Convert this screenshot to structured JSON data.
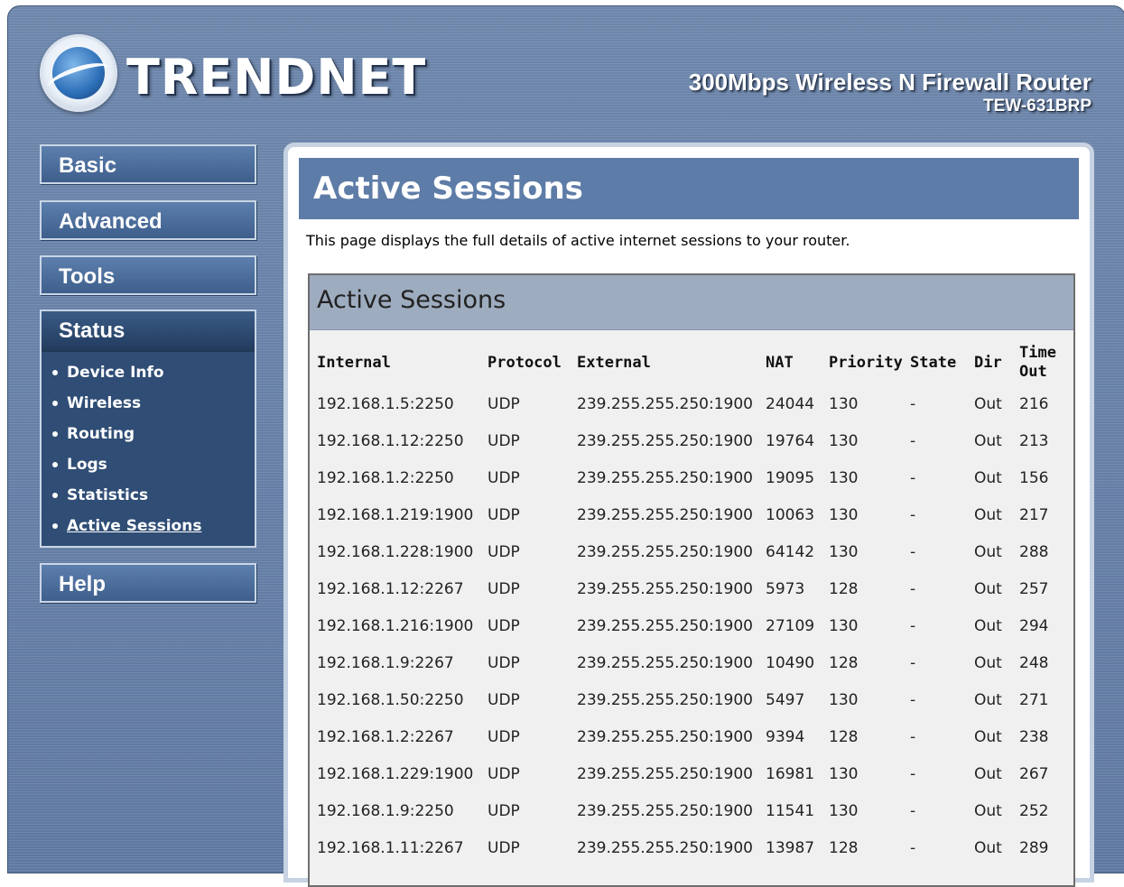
{
  "header": {
    "brand": "TRENDNET",
    "product_name": "300Mbps Wireless N Firewall Router",
    "model": "TEW-631BRP"
  },
  "sidebar": {
    "menu": [
      "Basic",
      "Advanced",
      "Tools",
      "Status",
      "Help"
    ],
    "status_items": [
      "Device Info",
      "Wireless",
      "Routing",
      "Logs",
      "Statistics",
      "Active Sessions"
    ],
    "active_item": "Active Sessions"
  },
  "page": {
    "title": "Active Sessions",
    "description": "This page displays the full details of active internet sessions to your router."
  },
  "sessions": {
    "box_title": "Active Sessions",
    "columns": [
      "Internal",
      "Protocol",
      "External",
      "NAT",
      "Priority",
      "State",
      "Dir",
      "Time Out"
    ],
    "rows": [
      [
        "192.168.1.5:2250",
        "UDP",
        "239.255.255.250:1900",
        "24044",
        "130",
        "-",
        "Out",
        "216"
      ],
      [
        "192.168.1.12:2250",
        "UDP",
        "239.255.255.250:1900",
        "19764",
        "130",
        "-",
        "Out",
        "213"
      ],
      [
        "192.168.1.2:2250",
        "UDP",
        "239.255.255.250:1900",
        "19095",
        "130",
        "-",
        "Out",
        "156"
      ],
      [
        "192.168.1.219:1900",
        "UDP",
        "239.255.255.250:1900",
        "10063",
        "130",
        "-",
        "Out",
        "217"
      ],
      [
        "192.168.1.228:1900",
        "UDP",
        "239.255.255.250:1900",
        "64142",
        "130",
        "-",
        "Out",
        "288"
      ],
      [
        "192.168.1.12:2267",
        "UDP",
        "239.255.255.250:1900",
        "5973",
        "128",
        "-",
        "Out",
        "257"
      ],
      [
        "192.168.1.216:1900",
        "UDP",
        "239.255.255.250:1900",
        "27109",
        "130",
        "-",
        "Out",
        "294"
      ],
      [
        "192.168.1.9:2267",
        "UDP",
        "239.255.255.250:1900",
        "10490",
        "128",
        "-",
        "Out",
        "248"
      ],
      [
        "192.168.1.50:2250",
        "UDP",
        "239.255.255.250:1900",
        "5497",
        "130",
        "-",
        "Out",
        "271"
      ],
      [
        "192.168.1.2:2267",
        "UDP",
        "239.255.255.250:1900",
        "9394",
        "128",
        "-",
        "Out",
        "238"
      ],
      [
        "192.168.1.229:1900",
        "UDP",
        "239.255.255.250:1900",
        "16981",
        "130",
        "-",
        "Out",
        "267"
      ],
      [
        "192.168.1.9:2250",
        "UDP",
        "239.255.255.250:1900",
        "11541",
        "130",
        "-",
        "Out",
        "252"
      ],
      [
        "192.168.1.11:2267",
        "UDP",
        "239.255.255.250:1900",
        "13987",
        "128",
        "-",
        "Out",
        "289"
      ]
    ]
  }
}
